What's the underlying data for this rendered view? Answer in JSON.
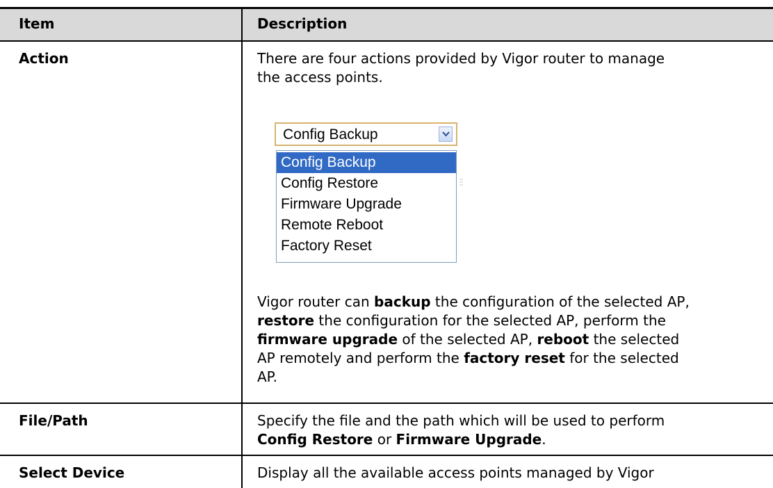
{
  "header": {
    "item": "Item",
    "description": "Description"
  },
  "rows": {
    "action": {
      "item": "Action",
      "intro_line1": "There are four actions provided by Vigor router to manage",
      "intro_line2": "the access points.",
      "dropdown": {
        "selected": "Config Backup",
        "options": [
          "Config Backup",
          "Config Restore",
          "Firmware Upgrade",
          "Remote Reboot",
          "Factory Reset"
        ]
      },
      "p2": {
        "a": "Vigor router can ",
        "b": "backup",
        "c": " the configuration of the selected AP,",
        "d": "restore",
        "e": " the configuration for the selected AP, perform the",
        "f": "firmware upgrade",
        "g": " of the selected AP, ",
        "h": "reboot",
        "i": " the selected",
        "j": "AP remotely and perform the ",
        "k": "factory reset",
        "l": " for the selected",
        "m": "AP."
      }
    },
    "file_path": {
      "item": "File/Path",
      "line1": "Specify the file and the path which will be used to perform",
      "b1": "Config Restore",
      "mid": " or ",
      "b2": "Firmware Upgrade",
      "end": "."
    },
    "select_device": {
      "item": "Select Device",
      "line1": "Display all the available access points managed by Vigor"
    }
  },
  "colors": {
    "header_bg": "#d9d9d9",
    "selected_option_bg": "#316ac5",
    "combo_border": "#d8b26f"
  }
}
